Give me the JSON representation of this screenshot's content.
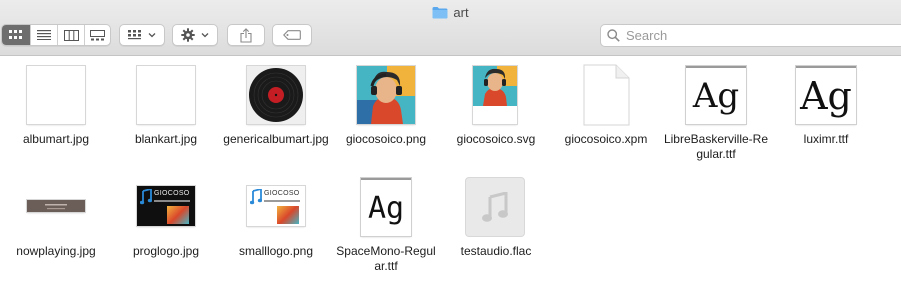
{
  "window": {
    "title": "art",
    "folder_icon": "folder-icon"
  },
  "toolbar": {
    "view_modes": [
      "icon-view",
      "list-view",
      "column-view",
      "gallery-view"
    ],
    "active_view": "icon-view",
    "group_menu_icon": "group-by-icon",
    "action_menu_icon": "gear-icon",
    "share_icon": "share-icon",
    "tags_icon": "tag-icon"
  },
  "search": {
    "placeholder": "Search",
    "value": ""
  },
  "files": [
    {
      "name": "albumart.jpg",
      "kind": "blank-image"
    },
    {
      "name": "blankart.jpg",
      "kind": "blank-image"
    },
    {
      "name": "genericalbumart.jpg",
      "kind": "vinyl-image"
    },
    {
      "name": "giocosoico.png",
      "kind": "portrait-image"
    },
    {
      "name": "giocosoico.svg",
      "kind": "portrait-small-image"
    },
    {
      "name": "giocosoico.xpm",
      "kind": "generic-document"
    },
    {
      "name": "LibreBaskerville-Regular.ttf",
      "kind": "font-serif",
      "glyph": "Ag"
    },
    {
      "name": "luximr.ttf",
      "kind": "font-mono-serif",
      "glyph": "Ag"
    },
    {
      "name": "nowplaying.jpg",
      "kind": "banner-image"
    },
    {
      "name": "proglogo.jpg",
      "kind": "logo-dark-image",
      "logo_text": "GIOCOSO"
    },
    {
      "name": "smalllogo.png",
      "kind": "logo-light-image",
      "logo_text": "GIOCOSO"
    },
    {
      "name": "SpaceMono-Regular.ttf",
      "kind": "font-mono",
      "glyph": "Ag"
    },
    {
      "name": "testaudio.flac",
      "kind": "audio-file"
    }
  ],
  "colors": {
    "folder_blue": "#5aa9ee",
    "active_view_bg": "#6e6e6e",
    "vinyl_label": "#c41e24",
    "logo_blue": "#2a8ad8"
  }
}
